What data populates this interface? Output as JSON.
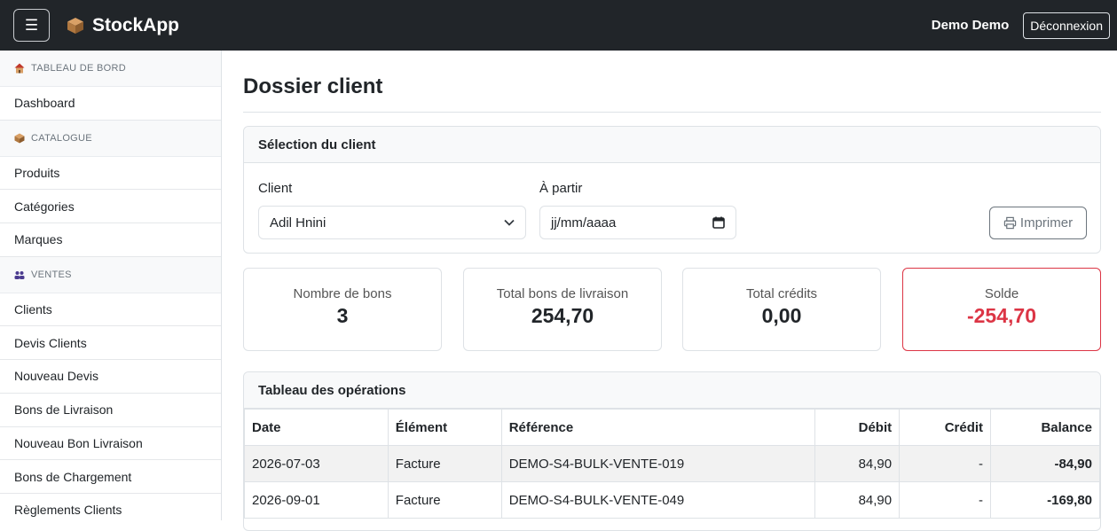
{
  "app": {
    "name": "StockApp",
    "user": "Demo Demo",
    "logout_label": "Déconnexion"
  },
  "sidebar": {
    "sections": [
      {
        "title": "TABLEAU DE BORD",
        "items": [
          "Dashboard"
        ]
      },
      {
        "title": "CATALOGUE",
        "items": [
          "Produits",
          "Catégories",
          "Marques"
        ]
      },
      {
        "title": "VENTES",
        "items": [
          "Clients",
          "Devis Clients",
          "Nouveau Devis",
          "Bons de Livraison",
          "Nouveau Bon Livraison",
          "Bons de Chargement",
          "Règlements Clients"
        ]
      }
    ]
  },
  "page": {
    "title": "Dossier client"
  },
  "selection": {
    "header": "Sélection du client",
    "client_label": "Client",
    "client_value": "Adil Hnini",
    "from_label": "À partir",
    "date_placeholder": "jj/mm/aaaa",
    "print_label": "Imprimer"
  },
  "stats": [
    {
      "label": "Nombre de bons",
      "value": "3"
    },
    {
      "label": "Total bons de livraison",
      "value": "254,70"
    },
    {
      "label": "Total crédits",
      "value": "0,00"
    },
    {
      "label": "Solde",
      "value": "-254,70"
    }
  ],
  "operations": {
    "header": "Tableau des opérations",
    "columns": [
      "Date",
      "Élément",
      "Référence",
      "Débit",
      "Crédit",
      "Balance"
    ],
    "rows": [
      [
        "2026-07-03",
        "Facture",
        "DEMO-S4-BULK-VENTE-019",
        "84,90",
        "-",
        "-84,90"
      ],
      [
        "2026-09-01",
        "Facture",
        "DEMO-S4-BULK-VENTE-049",
        "84,90",
        "-",
        "-169,80"
      ]
    ]
  },
  "colors": {
    "navbar": "#212529",
    "danger": "#dc3545",
    "border": "#dee2e6"
  }
}
